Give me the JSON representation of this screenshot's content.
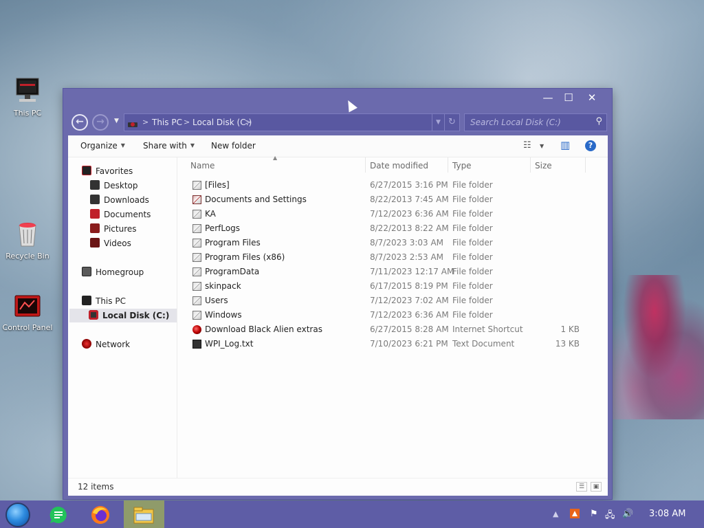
{
  "desktop": {
    "icons": [
      {
        "label": "This PC",
        "icon": "computer-icon"
      },
      {
        "label": "Recycle Bin",
        "icon": "recycle-bin-icon"
      },
      {
        "label": "Control Panel",
        "icon": "control-panel-icon"
      }
    ]
  },
  "window": {
    "title_buttons": {
      "minimize": "—",
      "maximize": "☐",
      "close": "✕"
    },
    "nav": {
      "back": "←",
      "forward": "→"
    },
    "address": {
      "crumbs": [
        "This PC",
        "Local Disk (C:)"
      ],
      "sep": ">"
    },
    "search": {
      "placeholder": "Search Local Disk (C:)"
    },
    "toolbar": {
      "organize": "Organize",
      "share_with": "Share with",
      "new_folder": "New folder"
    },
    "nav_pane": {
      "favorites": "Favorites",
      "desktop": "Desktop",
      "downloads": "Downloads",
      "documents": "Documents",
      "pictures": "Pictures",
      "videos": "Videos",
      "homegroup": "Homegroup",
      "this_pc": "This PC",
      "local_disk": "Local Disk (C:)",
      "network": "Network"
    },
    "columns": {
      "name": "Name",
      "date": "Date modified",
      "type": "Type",
      "size": "Size"
    },
    "files": [
      {
        "name": "[Files]",
        "date": "6/27/2015 3:16 PM",
        "type": "File folder",
        "size": "",
        "icon": "folder-icon"
      },
      {
        "name": "Documents and Settings",
        "date": "8/22/2013 7:45 AM",
        "type": "File folder",
        "size": "",
        "icon": "folder-shortcut-icon"
      },
      {
        "name": "KA",
        "date": "7/12/2023 6:36 AM",
        "type": "File folder",
        "size": "",
        "icon": "folder-icon"
      },
      {
        "name": "PerfLogs",
        "date": "8/22/2013 8:22 AM",
        "type": "File folder",
        "size": "",
        "icon": "folder-icon"
      },
      {
        "name": "Program Files",
        "date": "8/7/2023 3:03 AM",
        "type": "File folder",
        "size": "",
        "icon": "folder-icon"
      },
      {
        "name": "Program Files (x86)",
        "date": "8/7/2023 2:53 AM",
        "type": "File folder",
        "size": "",
        "icon": "folder-icon"
      },
      {
        "name": "ProgramData",
        "date": "7/11/2023 12:17 AM",
        "type": "File folder",
        "size": "",
        "icon": "folder-icon"
      },
      {
        "name": "skinpack",
        "date": "6/17/2015 8:19 PM",
        "type": "File folder",
        "size": "",
        "icon": "folder-icon"
      },
      {
        "name": "Users",
        "date": "7/12/2023 7:02 AM",
        "type": "File folder",
        "size": "",
        "icon": "folder-icon"
      },
      {
        "name": "Windows",
        "date": "7/12/2023 6:36 AM",
        "type": "File folder",
        "size": "",
        "icon": "folder-icon"
      },
      {
        "name": "Download Black Alien extras",
        "date": "6/27/2015 8:28 AM",
        "type": "Internet Shortcut",
        "size": "1 KB",
        "icon": "internet-shortcut-icon"
      },
      {
        "name": "WPI_Log.txt",
        "date": "7/10/2023 6:21 PM",
        "type": "Text Document",
        "size": "13 KB",
        "icon": "text-document-icon"
      }
    ],
    "status": {
      "count": "12 items"
    }
  },
  "taskbar": {
    "clock": "3:08 AM",
    "apps": [
      "start-orb-icon",
      "notes-app-icon",
      "firefox-icon",
      "file-explorer-icon"
    ]
  },
  "colors": {
    "window_frame": "#6b6aad",
    "taskbar": "#5e5da6",
    "active_app": "#8f9b6a"
  }
}
